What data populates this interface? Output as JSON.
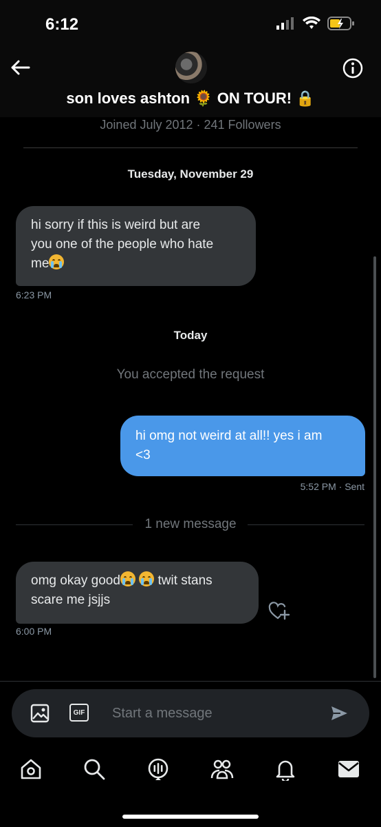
{
  "status_bar": {
    "time": "6:12"
  },
  "header": {
    "display_name": "son loves ashton 🌻 ON TOUR! 🔒",
    "joined": "Joined July 2012 · 241 Followers"
  },
  "conversation": {
    "sections": [
      {
        "date_label": "Tuesday, November 29",
        "message": {
          "text_parts": [
            "hi sorry if this is weird but are",
            "you one of the people who hate",
            "me"
          ],
          "time": "6:23 PM"
        }
      },
      {
        "date_label": "Today",
        "system_text": "You accepted the request",
        "sent_message": {
          "text_parts": [
            "hi omg not weird at all!! yes i am",
            "<3"
          ],
          "time": "5:52 PM · Sent"
        },
        "new_message_divider": "1 new message",
        "received_message": {
          "text_parts": [
            "omg okay good",
            "twit stans",
            "scare me jsjjs"
          ],
          "time": "6:00 PM"
        }
      }
    ]
  },
  "composer": {
    "placeholder": "Start a message",
    "gif_label": "GIF"
  },
  "nav": {
    "items": [
      "home-icon",
      "search-icon",
      "spaces-icon",
      "communities-icon",
      "notifications-icon",
      "messages-icon"
    ]
  },
  "colors": {
    "sent_bubble": "#4a98e9",
    "received_bubble": "#333639",
    "accent": "#1d9bf0"
  }
}
